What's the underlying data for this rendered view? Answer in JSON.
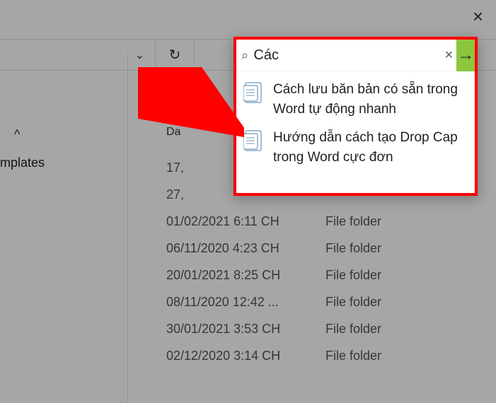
{
  "window": {
    "close_label": "×"
  },
  "toolbar": {
    "chevron": "⌄",
    "refresh": "↻"
  },
  "columns": {
    "date_header": "Da",
    "sort_indicator": "^",
    "type_label": "File folder"
  },
  "left_items": [
    "mplates"
  ],
  "rows": [
    {
      "date": "17,",
      "type": ""
    },
    {
      "date": "27,",
      "type": ""
    },
    {
      "date": "01/02/2021 6:11 CH",
      "type": "File folder"
    },
    {
      "date": "06/11/2020 4:23 CH",
      "type": "File folder"
    },
    {
      "date": "20/01/2021 8:25 CH",
      "type": "File folder"
    },
    {
      "date": "08/11/2020 12:42 ...",
      "type": "File folder"
    },
    {
      "date": "30/01/2021 3:53 CH",
      "type": "File folder"
    },
    {
      "date": "02/12/2020 3:14 CH",
      "type": "File folder"
    }
  ],
  "search": {
    "icon": "⌕",
    "value": "Các",
    "clear": "×",
    "go": "→",
    "suggestions": [
      "Cách lưu băn bản có sẵn trong Word tự động nhanh",
      "Hướng dẫn cách tạo Drop Cap trong Word cực đơn"
    ]
  },
  "colors": {
    "accent_green": "#8cc63f",
    "highlight_red": "#ff0000"
  }
}
